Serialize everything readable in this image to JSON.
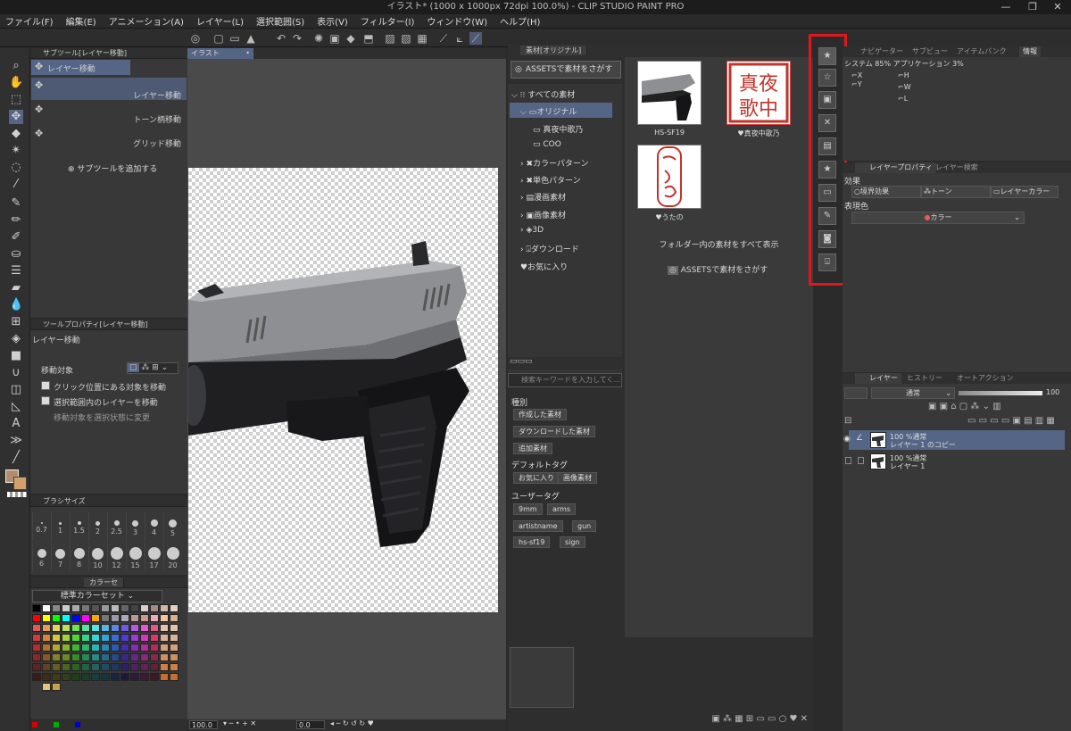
{
  "window": {
    "title": "イラスト* (1000 x 1000px 72dpi 100.0%)  - CLIP STUDIO PAINT PRO"
  },
  "menu": [
    "ファイル(F)",
    "編集(E)",
    "アニメーション(A)",
    "レイヤー(L)",
    "選択範囲(S)",
    "表示(V)",
    "フィルター(I)",
    "ウィンドウ(W)",
    "ヘルプ(H)"
  ],
  "subtool": {
    "title": "サブツール[レイヤー移動]",
    "active_tab": "レイヤー移動",
    "items": [
      "レイヤー移動",
      "トーン柄移動",
      "グリッド移動"
    ],
    "add_label": "サブツールを追加する"
  },
  "toolprop": {
    "title": "ツールプロパティ[レイヤー移動]",
    "name": "レイヤー移動",
    "move_target_label": "移動対象",
    "options": [
      "クリック位置にある対象を移動",
      "選択範囲内のレイヤーを移動",
      "移動対象を選択状態に変更"
    ]
  },
  "brushsize": {
    "title": "ブラシサイズ",
    "sizes": [
      "0.7",
      "1",
      "1.5",
      "2",
      "2.5",
      "3",
      "4",
      "5",
      "6",
      "7",
      "8",
      "10",
      "12",
      "15",
      "17",
      "20"
    ]
  },
  "colorset": {
    "tab_label": "カラーセ",
    "set_name": "標準カラーセット"
  },
  "canvas": {
    "tab_label": "イラスト",
    "zoom": "100.0",
    "angle": "0.0"
  },
  "material": {
    "title": "素材[オリジナル]",
    "assets_button": "ASSETSで素材をさがす",
    "tree": [
      "すべての素材",
      "オリジナル",
      "真夜中歌乃",
      "COO",
      "カラーパターン",
      "単色パターン",
      "漫画素材",
      "画像素材",
      "3D",
      "ダウンロード",
      "お気に入り"
    ],
    "items": [
      "HS-SF19",
      "真夜中歌乃",
      "うたの"
    ],
    "show_all": "フォルダー内の素材をすべて表示",
    "assets_link": "ASSETSで素材をさがす",
    "search_placeholder": "検索キーワードを入力してく...",
    "kind_label": "種別",
    "kinds": [
      "作成した素材",
      "ダウンロードした素材",
      "追加素材"
    ],
    "default_tag_label": "デフォルトタグ",
    "default_tags": [
      "お気に入り",
      "画像素材"
    ],
    "user_tag_label": "ユーザータグ",
    "user_tags": [
      "9mm",
      "arms",
      "artistname",
      "gun",
      "hs-sf19",
      "sign"
    ]
  },
  "navigator": {
    "tabs": [
      "ナビゲーター",
      "サブビュー",
      "アイテムバンク",
      "情報"
    ],
    "system_text": "システム 85%  アプリケーション 3%",
    "fields": [
      "X",
      "Y",
      "H",
      "W",
      "L"
    ]
  },
  "layerprop": {
    "tabs": [
      "レイヤープロパティ",
      "レイヤー検索"
    ],
    "effect_label": "効果",
    "effects": [
      "境界効果",
      "トーン",
      "レイヤーカラー"
    ],
    "expression_label": "表現色",
    "expression_value": "カラー"
  },
  "layers": {
    "tabs": [
      "レイヤー",
      "ヒストリー",
      "オートアクション"
    ],
    "blend_mode": "通常",
    "opacity": "100",
    "rows": [
      {
        "mode": "100 %通常",
        "name": "レイヤー 1 のコピー"
      },
      {
        "mode": "100 %通常",
        "name": "レイヤー 1"
      }
    ]
  },
  "colors": {
    "accent": "#e0171b",
    "selected_row": "#556586"
  }
}
